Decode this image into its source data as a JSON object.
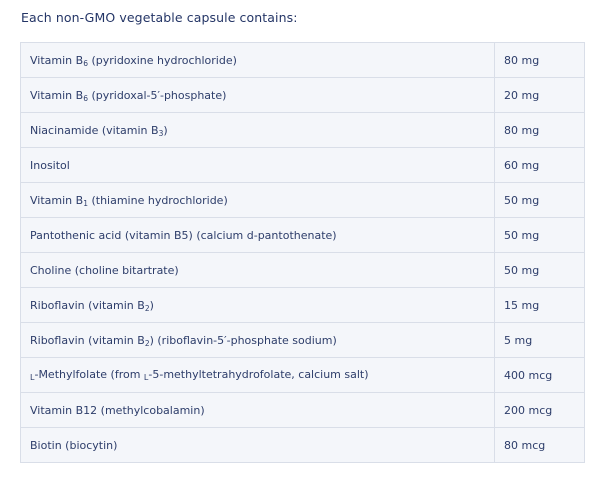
{
  "heading": "Each non-GMO vegetable capsule contains:",
  "rows": [
    {
      "prefix": "Vitamin B",
      "sub": "6",
      "suffix": " (pyridoxine hydrochloride)",
      "amount": "80 mg"
    },
    {
      "prefix": "Vitamin B",
      "sub": "6",
      "suffix": " (pyridoxal-5′-phosphate)",
      "amount": "20 mg"
    },
    {
      "prefix": "Niacinamide (vitamin B",
      "sub": "3",
      "suffix": ")",
      "amount": "80 mg"
    },
    {
      "prefix": "Inositol",
      "sub": "",
      "suffix": "",
      "amount": "60 mg"
    },
    {
      "prefix": "Vitamin B",
      "sub": "1",
      "suffix": " (thiamine hydrochloride)",
      "amount": "50 mg"
    },
    {
      "prefix": "Pantothenic acid (vitamin B5) (calcium d-pantothenate)",
      "sub": "",
      "suffix": "",
      "amount": "50 mg"
    },
    {
      "prefix": "Choline (choline bitartrate)",
      "sub": "",
      "suffix": "",
      "amount": "50 mg"
    },
    {
      "prefix": "Riboflavin (vitamin B",
      "sub": "2",
      "suffix": ")",
      "amount": "15 mg"
    },
    {
      "prefix": "Riboflavin (vitamin B",
      "sub": "2",
      "suffix": ") (riboflavin-5′-phosphate sodium)",
      "amount": "5 mg"
    },
    {
      "sc1": "L",
      "part1": "-Methylfolate (from ",
      "sc2": "L",
      "part2": "-5-methyltetrahydrofolate, calcium salt)",
      "amount": "400 mcg"
    },
    {
      "prefix": "Vitamin B12 (methylcobalamin)",
      "sub": "",
      "suffix": "",
      "amount": "200 mcg"
    },
    {
      "prefix": "Biotin (biocytin)",
      "sub": "",
      "suffix": "",
      "amount": "80 mcg"
    }
  ]
}
